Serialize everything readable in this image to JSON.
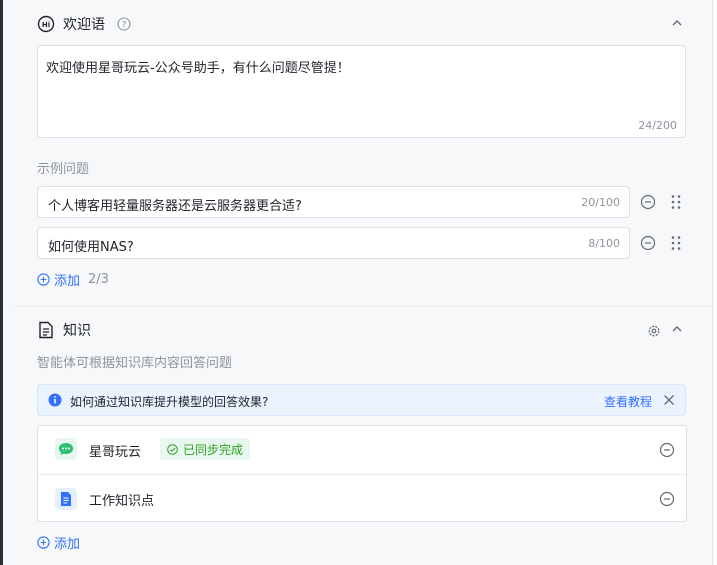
{
  "welcome": {
    "title": "欢迎语",
    "text": "欢迎使用星哥玩云-公众号助手，有什么问题尽管提！",
    "counter": "24/200"
  },
  "examples": {
    "label": "示例问题",
    "items": [
      {
        "text": "个人博客用轻量服务器还是云服务器更合适?",
        "count": "20/100"
      },
      {
        "text": "如何使用NAS?",
        "count": "8/100"
      }
    ],
    "add_label": "添加",
    "add_count": "2/3"
  },
  "knowledge": {
    "title": "知识",
    "description": "智能体可根据知识库内容回答问题",
    "tip_text": "如何通过知识库提升模型的回答效果?",
    "tip_link": "查看教程",
    "items": [
      {
        "name": "星哥玩云",
        "badge": "已同步完成",
        "icon": "chat-bubble-icon"
      },
      {
        "name": "工作知识点",
        "badge": "",
        "icon": "document-icon"
      }
    ],
    "add_label": "添加"
  },
  "colors": {
    "accent": "#3370ff",
    "success": "#2ea121",
    "bubble": "#2fbf71"
  }
}
